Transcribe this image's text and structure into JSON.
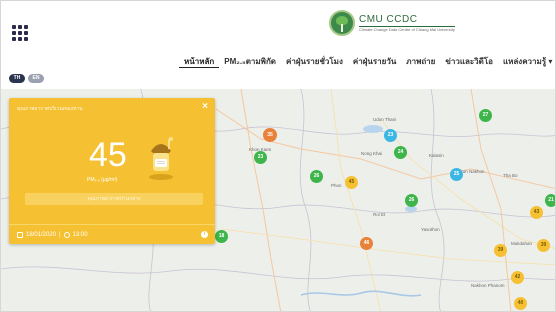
{
  "header": {
    "logo_title": "CMU CCDC",
    "logo_subtitle": "Climate Change Data Centre of Chiang Mai University",
    "nav": [
      {
        "label": "หน้าหลัก",
        "active": true
      },
      {
        "label": "PM₂.₅ตามพิกัด"
      },
      {
        "label": "ค่าฝุ่นรายชั่วโมง"
      },
      {
        "label": "ค่าฝุ่นรายวัน"
      },
      {
        "label": "ภาพถ่าย"
      },
      {
        "label": "ข่าวและวิดีโอ"
      },
      {
        "label": "แหล่งความรู้ ▾"
      }
    ]
  },
  "lang": {
    "th": "TH",
    "en": "EN"
  },
  "panel": {
    "title": "คุณภาพอากาศบริเวณของท่าน",
    "value": "45",
    "unit": "PM₂.₅ (µg/m³)",
    "description": "คุณภาพอากาศปานกลาง",
    "date": "18/01/2020",
    "time": "13:00",
    "close": "×",
    "info": "i",
    "separator": "|",
    "color": "#f5c132"
  },
  "map": {
    "markers": [
      {
        "value": "35",
        "color": "#e8823a"
      },
      {
        "value": "23",
        "color": "#3db54a"
      },
      {
        "value": "26",
        "color": "#3db54a"
      },
      {
        "value": "45",
        "color": "#f5c132"
      },
      {
        "value": "23",
        "color": "#3cb6e3"
      },
      {
        "value": "24",
        "color": "#3db54a"
      },
      {
        "value": "27",
        "color": "#3db54a"
      },
      {
        "value": "25",
        "color": "#3cb6e3"
      },
      {
        "value": "26",
        "color": "#3db54a"
      },
      {
        "value": "46",
        "color": "#e8823a"
      },
      {
        "value": "18",
        "color": "#3db54a"
      },
      {
        "value": "43",
        "color": "#f5c132"
      },
      {
        "value": "39",
        "color": "#f5c132"
      },
      {
        "value": "39",
        "color": "#f5c132"
      },
      {
        "value": "42",
        "color": "#f5c132"
      },
      {
        "value": "40",
        "color": "#f5c132"
      },
      {
        "value": "21",
        "color": "#3db54a"
      }
    ],
    "places": [
      "Udon Thani",
      "Kalasin",
      "Sakon Nakhon",
      "Tha Bo",
      "Nong Khai",
      "Khon Kaen",
      "Roi Et",
      "Yasothon",
      "Mukdahan",
      "Phon",
      "Nakhon Phanom"
    ]
  }
}
